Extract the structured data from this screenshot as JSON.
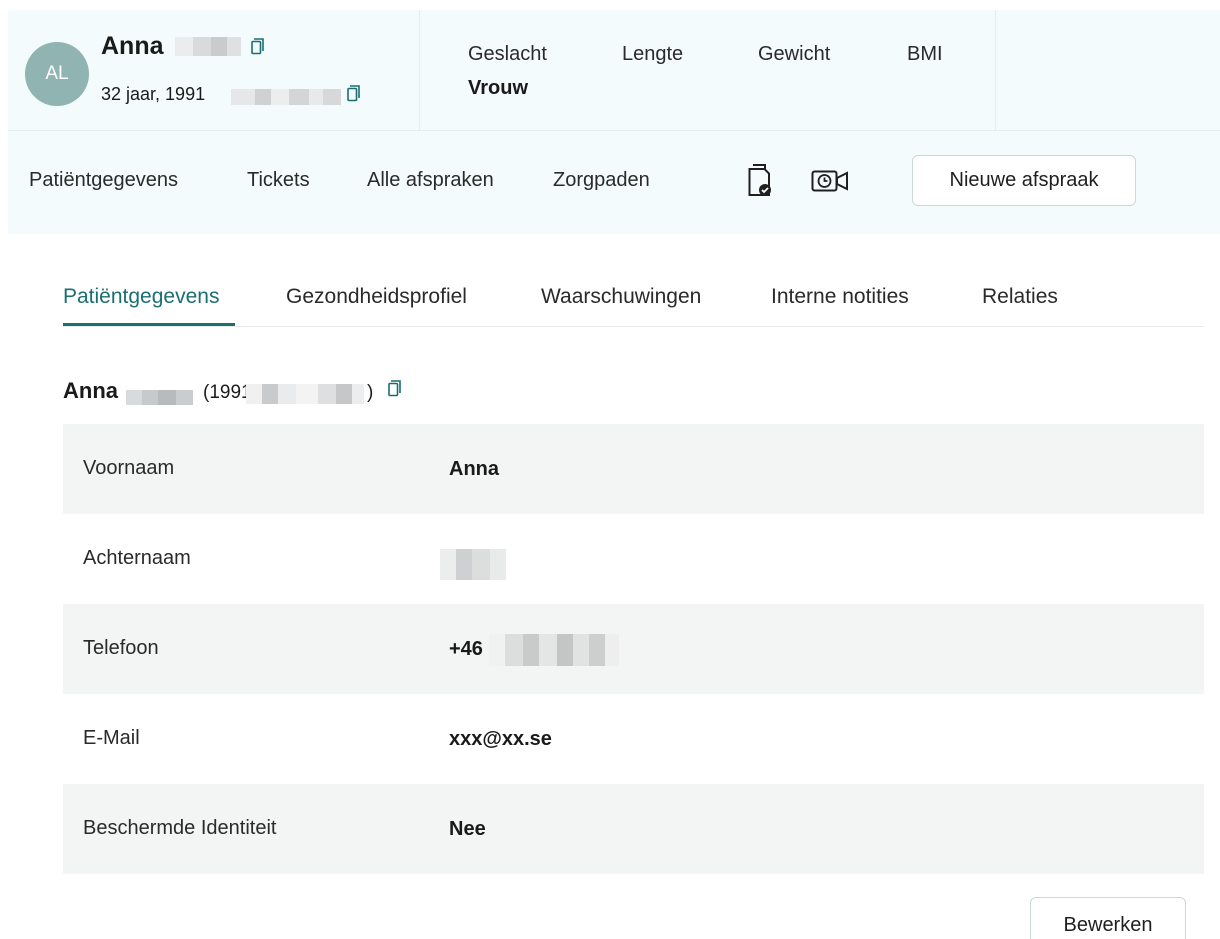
{
  "patient": {
    "initials": "AL",
    "first_name": "Anna",
    "age_line": "32 jaar, 1991",
    "icons": {
      "copy": "copy-icon",
      "doc": "document-check-icon",
      "video": "video-clock-icon"
    }
  },
  "stats": [
    {
      "label": "Geslacht",
      "value": "Vrouw"
    },
    {
      "label": "Lengte",
      "value": ""
    },
    {
      "label": "Gewicht",
      "value": ""
    },
    {
      "label": "BMI",
      "value": ""
    }
  ],
  "nav": {
    "items": [
      "Patiëntgegevens",
      "Tickets",
      "Alle afspraken",
      "Zorgpaden"
    ],
    "new_appointment": "Nieuwe afspraak"
  },
  "tabs": [
    {
      "label": "Patiëntgegevens",
      "active": true
    },
    {
      "label": "Gezondheidsprofiel",
      "active": false
    },
    {
      "label": "Waarschuwingen",
      "active": false
    },
    {
      "label": "Interne notities",
      "active": false
    },
    {
      "label": "Relaties",
      "active": false
    }
  ],
  "summary": {
    "name": "Anna",
    "open": "(1991",
    "close": ")"
  },
  "details": [
    {
      "label": "Voornaam",
      "value": "Anna"
    },
    {
      "label": "Achternaam",
      "value": ""
    },
    {
      "label": "Telefoon",
      "value": "+46"
    },
    {
      "label": "E-Mail",
      "value": "xxx@xx.se"
    },
    {
      "label": "Beschermde Identiteit",
      "value": "Nee"
    }
  ],
  "edit_button": "Bewerken",
  "colors": {
    "accent": "#1b6e71",
    "header_bg": "#f4fbfc",
    "avatar_bg": "#8fb4b1",
    "row_shade": "#f3f4f4"
  }
}
